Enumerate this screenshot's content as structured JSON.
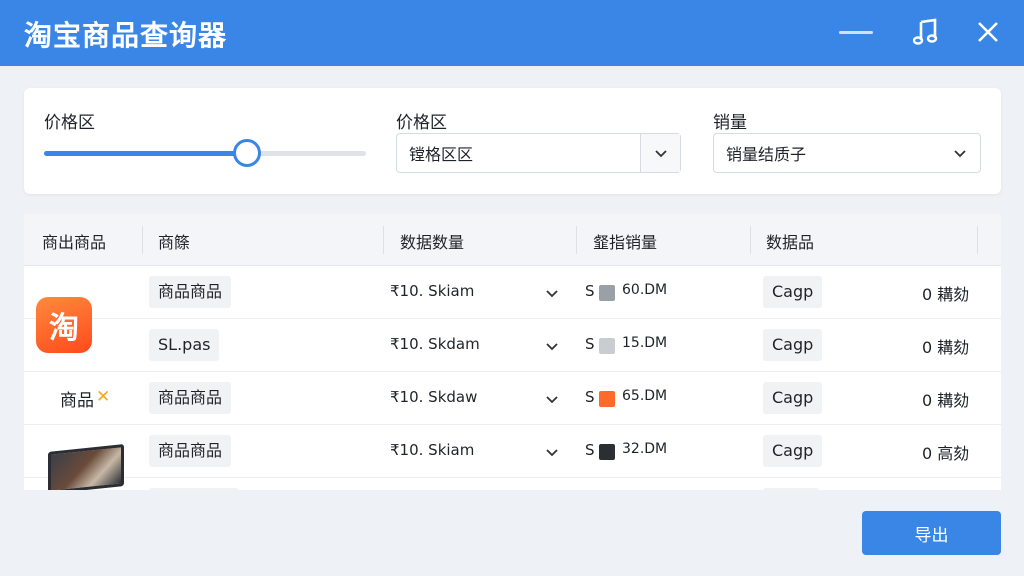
{
  "window": {
    "title": "淘宝商品查询器",
    "controls": {
      "minimize": "minimize-icon",
      "music": "music-note-icon",
      "close": "close-icon"
    }
  },
  "filters": {
    "price_range": {
      "label": "价格区",
      "slider_value_percent": 63
    },
    "price_select": {
      "label": "价格区",
      "value": "镗格区区"
    },
    "sales_select": {
      "label": "销量",
      "value": "销量结质子"
    }
  },
  "table": {
    "columns": [
      "商出商品",
      "商篨",
      "数据数量",
      "韰指销量",
      "数据品"
    ],
    "rows": [
      {
        "name": "商品商品",
        "price": "₹10. Skiam",
        "sales_prefix": "S",
        "sales": "60.DM",
        "category": "Cagp",
        "status": "0 耩劾",
        "icon_color": "#9aa0a8"
      },
      {
        "name": "SL.pas",
        "price": "₹10. Skdam",
        "sales_prefix": "S",
        "sales": "15.DM",
        "category": "Cagp",
        "status": "0 耩劾",
        "icon_color": "#c9ccd1"
      },
      {
        "name": "商品商品",
        "price": "₹10. Skdaw",
        "sales_prefix": "S",
        "sales": "65.DM",
        "category": "Cagp",
        "status": "0 耩劾",
        "icon_color": "#ff6a2b"
      },
      {
        "name": "商品商品",
        "price": "₹10. Skiam",
        "sales_prefix": "S",
        "sales": "32.DM",
        "category": "Cagp",
        "status": "0 高劾",
        "icon_color": "#2b2e33"
      }
    ],
    "product_images": {
      "app_logo_text": "淘",
      "brand_text": "商品",
      "brand_mark": "✕"
    }
  },
  "footer": {
    "export_label": "导出"
  },
  "colors": {
    "accent": "#3a86e6",
    "logo_orange": "#ff5a22"
  }
}
